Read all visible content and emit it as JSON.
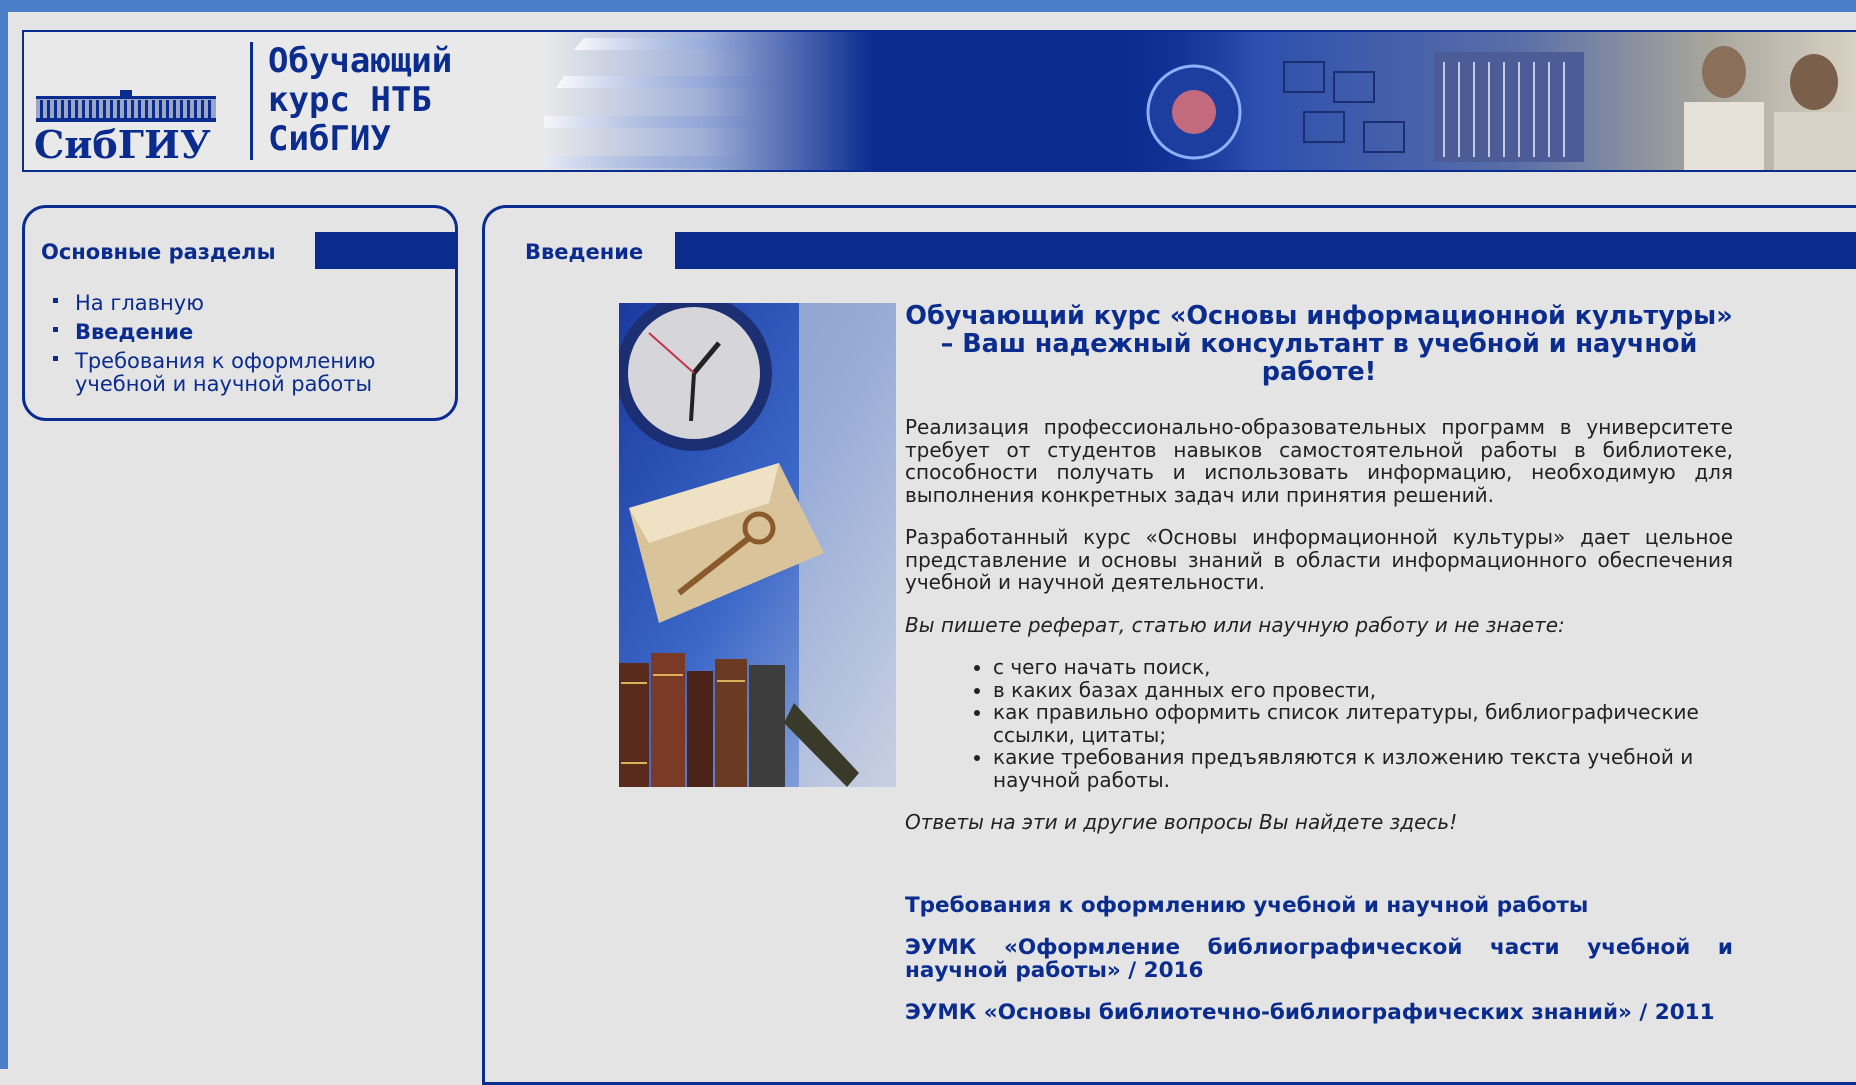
{
  "header": {
    "logo_text": "СибГИУ",
    "site_title": "Обучающий\nкурс НТБ\nСибГИУ"
  },
  "sidebar": {
    "tab_label": "Основные разделы",
    "items": [
      {
        "label": "На главную",
        "active": false
      },
      {
        "label": "Введение",
        "active": true
      },
      {
        "label": "Требования к оформлению учебной и научной работы",
        "active": false
      }
    ]
  },
  "main": {
    "tab_label": "Введение",
    "heading": "Обучающий курс «Основы информационной культуры» – Ваш надежный консультант в учебной и научной работе!",
    "paragraphs": [
      "Реализация профессионально-образовательных программ в университете требует от студентов навыков самостоятельной работы в библиотеке, способности получать и использовать информацию, необходимую для выполнения конкретных задач или принятия решений.",
      "Разработанный курс «Основы информационной культуры» дает цельное представление и основы знаний в области информационного обеспечения учебной и научной деятельности."
    ],
    "question_intro": "Вы пишете реферат, статью или научную работу и не знаете:",
    "bullets": [
      "с чего начать поиск,",
      "в каких базах данных его провести,",
      "как правильно оформить список литературы, библиографические ссылки, цитаты;",
      "какие требования предъявляются к изложению текста учебной и научной работы."
    ],
    "answer_line": "Ответы на эти и другие вопросы Вы найдете здесь!",
    "links": [
      "Требования к оформлению учебной и научной работы",
      "ЭУМК «Оформление библиографической части учебной и научной работы» / 2016",
      "ЭУМК «Основы библиотечно-библиографических знаний» / 2011"
    ]
  },
  "colors": {
    "brand": "#0b2c8f",
    "frame": "#4a7ec8",
    "background": "#e4e4e4"
  }
}
